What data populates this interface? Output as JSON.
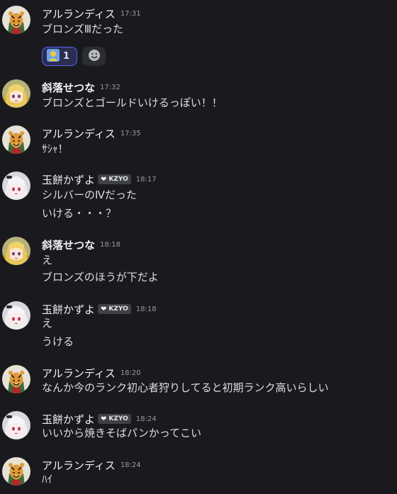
{
  "messages": [
    {
      "author": "アルランディス",
      "time": "17:31",
      "avatar": "tiger-avatar",
      "bold": false,
      "lines": [
        "ブロンズⅢだった"
      ],
      "reaction": {
        "emoji": "person-emoji",
        "count": "1"
      }
    },
    {
      "author": "斜落せつな",
      "time": "17:32",
      "avatar": "blonde-avatar",
      "bold": true,
      "lines": [
        "ブロンズとゴールドいけるっぽい！！"
      ]
    },
    {
      "author": "アルランディス",
      "time": "17:35",
      "avatar": "tiger-avatar",
      "bold": false,
      "lines": [
        "ｻｼｬ！"
      ]
    },
    {
      "author": "玉餅かずよ",
      "time": "18:17",
      "avatar": "silver-avatar",
      "bold": false,
      "tag": "KZYO",
      "lines": [
        "シルバーのⅣだった",
        "いける・・・？"
      ]
    },
    {
      "author": "斜落せつな",
      "time": "18:18",
      "avatar": "blonde-avatar",
      "bold": true,
      "lines": [
        "え",
        "ブロンズのほうが下だよ"
      ]
    },
    {
      "author": "玉餅かずよ",
      "time": "18:18",
      "avatar": "silver-avatar",
      "bold": false,
      "tag": "KZYO",
      "lines": [
        "え",
        "うける"
      ]
    },
    {
      "author": "アルランディス",
      "time": "18:20",
      "avatar": "tiger-avatar",
      "bold": false,
      "lines": [
        "なんか今のランク初心者狩りしてると初期ランク高いらしい"
      ]
    },
    {
      "author": "玉餅かずよ",
      "time": "18:24",
      "avatar": "silver-avatar",
      "bold": false,
      "tag": "KZYO",
      "lines": [
        "いいから焼きそばパンかってこい"
      ]
    },
    {
      "author": "アルランディス",
      "time": "18:24",
      "avatar": "tiger-avatar",
      "bold": false,
      "lines": [
        "ﾊｲ"
      ]
    }
  ]
}
